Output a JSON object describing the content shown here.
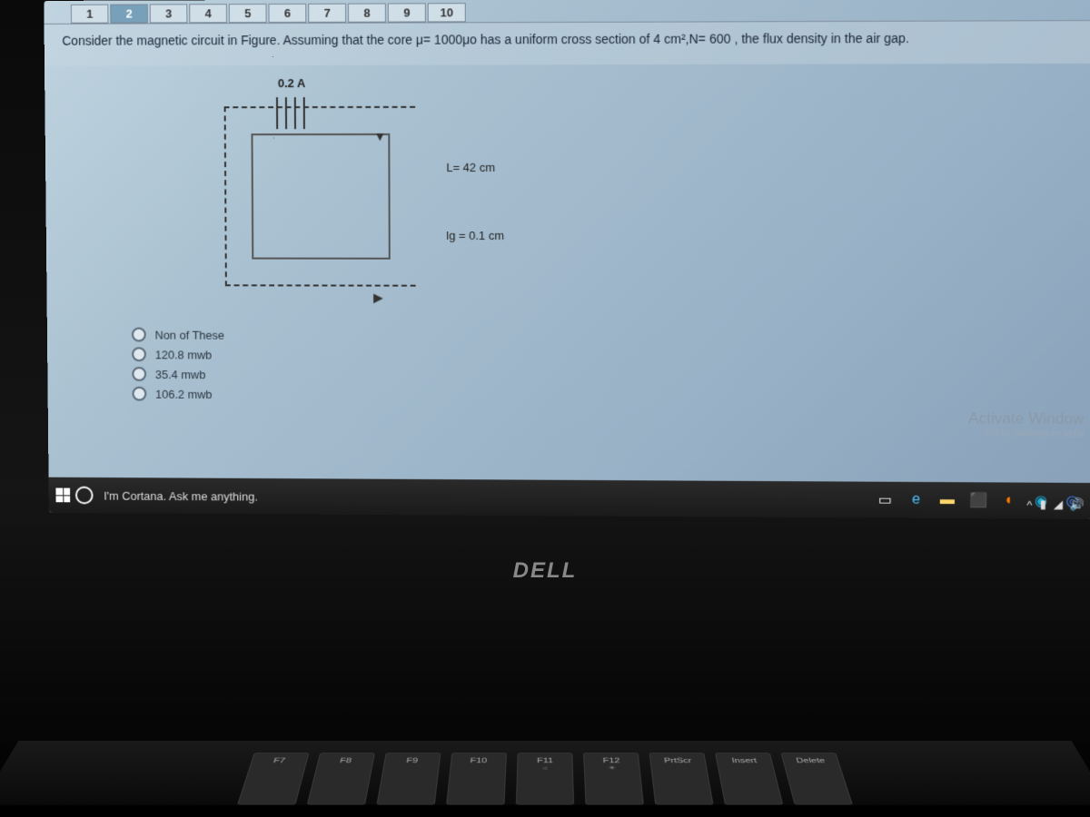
{
  "tabs": [
    "1",
    "2",
    "3",
    "4",
    "5",
    "6",
    "7",
    "8",
    "9",
    "10"
  ],
  "active_tab": 1,
  "question": "Consider the magnetic circuit in Figure. Assuming that the core μ= 1000μo has a uniform cross section of 4 cm²,N= 600 , the flux density in the air gap.",
  "diagram": {
    "current": "0.2 A",
    "length": "L= 42 cm",
    "gap": "lg = 0.1 cm"
  },
  "options": [
    "Non of These",
    "120.8 mwb",
    "35.4 mwb",
    "106.2 mwb"
  ],
  "watermark": {
    "title": "Activate Window",
    "sub": "Go to Settings to activ"
  },
  "cortana": "I'm Cortana. Ask me anything.",
  "laptop": "DELL",
  "keys": [
    {
      "main": "F7",
      "sub": ""
    },
    {
      "main": "F8",
      "sub": ""
    },
    {
      "main": "F9",
      "sub": ""
    },
    {
      "main": "F10",
      "sub": ""
    },
    {
      "main": "F11",
      "sub": "☼"
    },
    {
      "main": "F12",
      "sub": "☀"
    },
    {
      "main": "PrtScr",
      "sub": ""
    },
    {
      "main": "Insert",
      "sub": ""
    },
    {
      "main": "Delete",
      "sub": ""
    }
  ]
}
